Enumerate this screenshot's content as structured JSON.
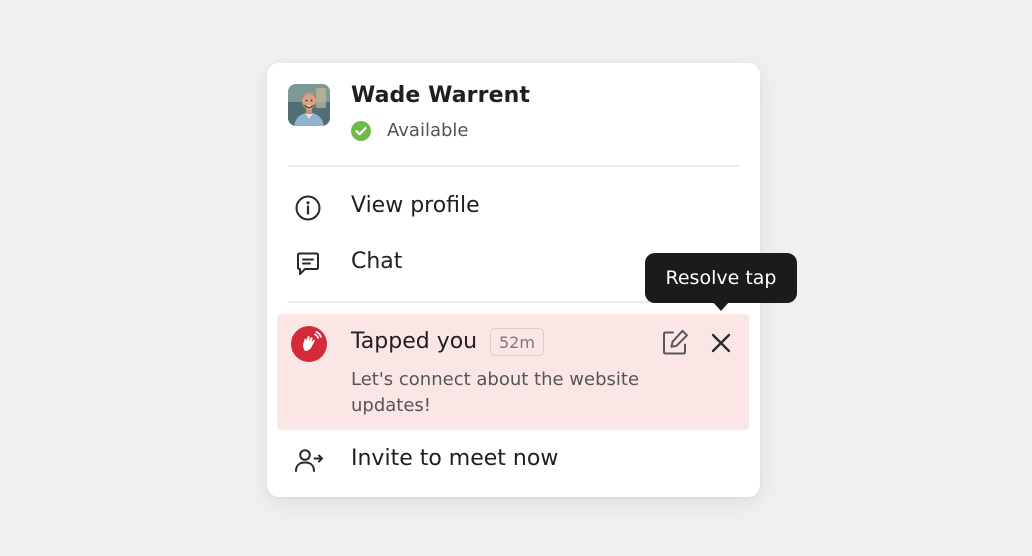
{
  "user": {
    "name": "Wade Warrent",
    "status": "Available",
    "status_color": "#6dbb4b"
  },
  "menu": {
    "view_profile": "View profile",
    "chat": "Chat",
    "invite": "Invite to meet now"
  },
  "tap": {
    "title": "Tapped you",
    "time": "52m",
    "message": "Let's connect about the website updates!",
    "background_color": "#fbe6e6",
    "badge_color": "#d42a3a"
  },
  "tooltip": {
    "label": "Resolve tap"
  },
  "icons": {
    "view_profile": "info-icon",
    "chat": "chat-icon",
    "invite": "invite-user-icon",
    "tap_badge": "tap-hand-icon",
    "edit": "edit-icon",
    "close": "close-icon",
    "status": "check-circle-icon"
  }
}
